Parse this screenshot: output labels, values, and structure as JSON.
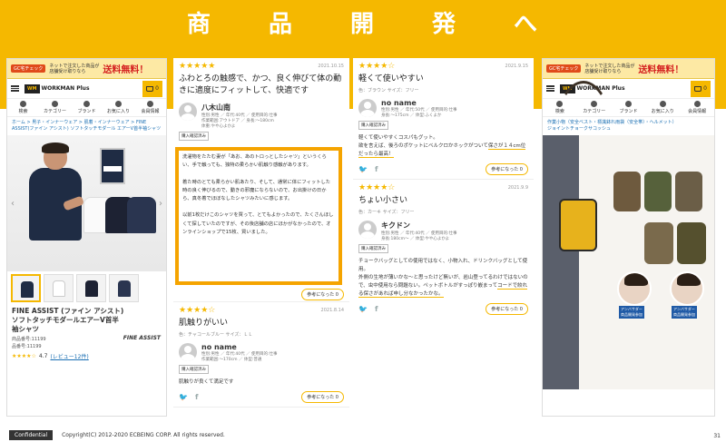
{
  "slide": {
    "title_chars": [
      "商",
      "品",
      "開",
      "発",
      "へ"
    ],
    "footer": {
      "confidential": "Confidential",
      "copyright": "Copyright(C) 2012-2020 ECBEING CORP. All rights reserved.",
      "page_number": "31"
    },
    "colors": {
      "brand_yellow": "#f5b800",
      "highlight_orange": "#f5a400",
      "link_blue": "#1a6fb3"
    }
  },
  "site": {
    "banner": {
      "logo": "GC宅チェック",
      "text_line1": "ネットで注文した商品が",
      "text_line2": "店舗受け取りなら",
      "big": "送料無料！"
    },
    "logo_box": "WM",
    "logo_text": "WORKMAN Plus",
    "cart_count": "0",
    "nav": [
      "検索",
      "カテゴリー",
      "ブランド",
      "お気に入り",
      "会員情報"
    ],
    "nav_icons": [
      "search-icon",
      "category-icon",
      "tag-icon",
      "heart-icon",
      "user-icon"
    ]
  },
  "product": {
    "breadcrumb": "ホーム > 男子・インナーウェア > 肌着・インナーウェア > FINE ASSIST(ファイン アシスト) ソフトタッチモダール エアーV首半袖シャツ",
    "name": "FINE ASSIST (ファイン アシスト) ソフトタッチモダールエアーV首半袖シャツ",
    "brand_mark": "FINE ASSIST",
    "code1": "商品番号:11199",
    "code2": "品番号:11199",
    "stars": "★★★★☆",
    "rating": "4.7",
    "review_link": "(レビュー12件)"
  },
  "reviews_mid": [
    {
      "stars": "★★★★★",
      "date": "2021.10.15",
      "title": "ふわとろの触感で、かつ、良く伸びて体の動きに適度にフィットして、快適です",
      "user": "八木山南",
      "meta1": "性別:男性 ／ 年代:40代 ／ 使用目的:仕事",
      "meta2": "作業範囲:アウトドア ／ 身長:〜180cm",
      "meta3": "体重:やや心よかよ",
      "verified": "購入確認済み",
      "body": "洗濯物をたたむ妻が「あお、あのトロっとしたシャツ」というくらい、手で触っても、独特の柔らかい肌触り感触があります。\n\n着た時のとても柔らかい肌あたり、そして、通常に体にフィットした時の良く伸びるので、動きの邪魔にならないので、お出掛けの日から、真冬着でほぼなしたシャツみたいに感じます。\n\n以前1枚だけこのシャツを買って、とてもよかったので、たくさんほしくて探していたのですが、その後店舗の店にほかがなかったので、オンラインショップで15枚、買いました。",
      "helpful": "参考になった 0"
    },
    {
      "stars": "★★★★☆",
      "date": "2021.8.14",
      "title": "肌触りがいい",
      "sub": "色：チャコールブルー サイズ：ＬＬ",
      "user": "no name",
      "meta1": "性別:男性 ／ 年代:40代 ／ 使用目的:仕事",
      "meta2": "作業範囲:〜170cm ／ 体型:普通",
      "verified": "購入確認済み",
      "body": "肌触りが良くて満足です",
      "helpful": "参考になった 0"
    }
  ],
  "reviews_right": [
    {
      "stars": "★★★★☆",
      "date": "2021.9.15",
      "title": "軽くて使いやすい",
      "sub": "色：ブラウン サイズ：フリー",
      "user": "no name",
      "meta1": "性別:男性 ／ 年代:50代 ／ 使用目的:仕事",
      "meta2": "身長:〜175cm ／ 体型:ふくよか",
      "verified": "購入確認済み",
      "body_plain": "軽くて使いやすくコスパもグット。\n欲を言えば、後ろのポケットにベルクロかホックがついて",
      "body_hl": "保さが１４cm位だったら最高！",
      "helpful": "参考になった 0"
    },
    {
      "stars": "★★★★☆",
      "date": "2021.9.9",
      "title": "ちょい小さい",
      "sub": "色：カーキ サイズ：フリー",
      "user": "キクドン",
      "meta1": "性別:男性 ／ 年代:40代 ／ 使用目的:仕事",
      "meta2": "身長:180cm〜 ／ 体型:やや心よかよ",
      "verified": "購入確認済み",
      "body_plain": "チョークバッグとしての使用ではなく、小物入れ、ドリンクバッグとして使用。\n外側の生地が薄いかな～と思ったけど無いが、岩山登ってるわけではないので、虫中使用なら問題ない。ペットボトルがすっぽり嵌まって",
      "body_hl": "コードで絞れる保さがあれば申し分なかったかな。",
      "helpful": "参考になった 0"
    }
  ],
  "chalkbag": {
    "breadcrumb1": "作業小物（安全ベスト・標識鉢れ雨袋（安全帯）・ヘルメット）",
    "breadcrumb2": "ジョイントチョークサコッシュ",
    "badge1": "アンバサダー\n商品開発参加",
    "badge2": "アンバサダー\n商品開発参加"
  }
}
